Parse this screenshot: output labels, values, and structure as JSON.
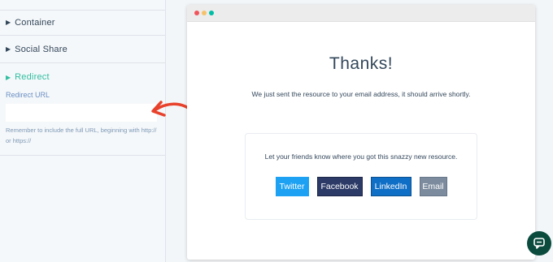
{
  "sidebar": {
    "sections": [
      {
        "label": "Container"
      },
      {
        "label": "Social Share"
      },
      {
        "label": "Redirect"
      }
    ],
    "redirect": {
      "field_label": "Redirect URL",
      "url_value": "",
      "help_text": "Remember to include the full URL, beginning with http:// or https://"
    }
  },
  "preview": {
    "heading": "Thanks!",
    "message": "We just sent the resource to your email address, it should arrive shortly.",
    "share_prompt": "Let your friends know where you got this snazzy new resource.",
    "share_buttons": [
      {
        "label": "Twitter"
      },
      {
        "label": "Facebook"
      },
      {
        "label": "LinkedIn"
      },
      {
        "label": "Email"
      }
    ]
  },
  "colors": {
    "accent": "#2fbfa0",
    "twitter": "#1da1f2",
    "facebook": "#2b3a67",
    "linkedin": "#0f6fc6",
    "email": "#7c8b9d",
    "annotation_arrow": "#e8412c",
    "chat_button": "#0b4b3e"
  },
  "icons": {
    "section_caret": "caret-right-icon",
    "annotation": "curved-arrow-icon",
    "chat": "chat-bubble-icon"
  }
}
